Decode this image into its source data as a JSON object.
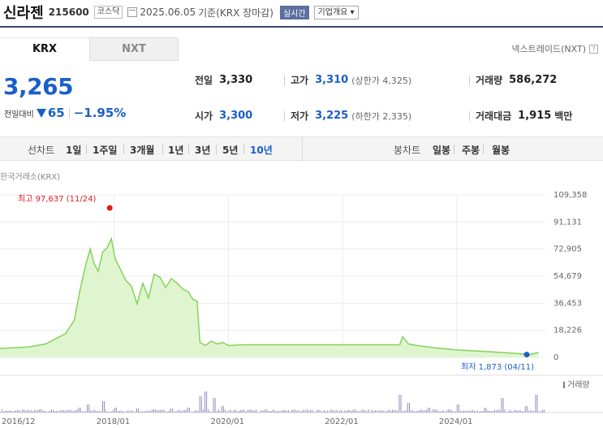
{
  "header": {
    "name": "신라젠",
    "code": "215600",
    "market": "코스닥",
    "date": "2025.06.05",
    "basis": "기준(KRX 장마감)",
    "live_label": "실시간",
    "info_label": "기업개요 ▾"
  },
  "tabs": [
    {
      "label": "KRX"
    },
    {
      "label": "NXT"
    }
  ],
  "nxt_link": "넥스트레이드(NXT)",
  "nxt_help": "?",
  "quote": {
    "price": "3,265",
    "change_label": "전일대비",
    "change_amount": "65",
    "change_pct": "−1.95%",
    "prev_close_label": "전일",
    "prev_close": "3,330",
    "high_label": "고가",
    "high": "3,310",
    "upper_limit": "(상한가 4,325)",
    "volume_label": "거래량",
    "volume": "586,272",
    "open_label": "시가",
    "open": "3,300",
    "low_label": "저가",
    "low": "3,225",
    "lower_limit": "(하한가 2,335)",
    "value_label": "거래대금",
    "value": "1,915",
    "value_unit": "백만"
  },
  "period_bar": {
    "line_label": "선차트",
    "periods": [
      "1일",
      "1주일",
      "3개월",
      "1년",
      "3년",
      "5년",
      "10년"
    ],
    "selected": "10년",
    "candle_label": "봉차트",
    "candles": [
      "일봉",
      "주봉",
      "월봉"
    ]
  },
  "chart_source": "한국거래소(KRX)",
  "colors": {
    "accent": "#1a5fc9",
    "line": "#86d35a",
    "fill": "#dff5cf",
    "high": "#e21b1b",
    "volume": "#7a6fb0"
  },
  "chart_data": {
    "type": "area",
    "y_ticks": [
      "109,358",
      "91,131",
      "72,905",
      "54,679",
      "36,453",
      "18,226",
      "0"
    ],
    "ylim": [
      0,
      109358
    ],
    "x_ticks": [
      "2016/12",
      "2018/01",
      "2020/01",
      "2022/01",
      "2024/01"
    ],
    "high_annotation": "최고 97,637 (11/24)",
    "low_annotation": "최저 1,873 (04/11)",
    "volume_label": "거래량",
    "series": [
      {
        "values": [
          [
            2016.0,
            6000
          ],
          [
            2016.5,
            7000
          ],
          [
            2016.8,
            9000
          ],
          [
            2017.0,
            13000
          ],
          [
            2017.15,
            16000
          ],
          [
            2017.3,
            25000
          ],
          [
            2017.4,
            45000
          ],
          [
            2017.5,
            62000
          ],
          [
            2017.58,
            73000
          ],
          [
            2017.65,
            63000
          ],
          [
            2017.72,
            58000
          ],
          [
            2017.8,
            71000
          ],
          [
            2017.88,
            74000
          ],
          [
            2017.95,
            80000
          ],
          [
            2018.02,
            66000
          ],
          [
            2018.1,
            60000
          ],
          [
            2018.2,
            52000
          ],
          [
            2018.3,
            48000
          ],
          [
            2018.4,
            36000
          ],
          [
            2018.5,
            50000
          ],
          [
            2018.6,
            40000
          ],
          [
            2018.7,
            56000
          ],
          [
            2018.8,
            54000
          ],
          [
            2018.9,
            47000
          ],
          [
            2019.0,
            53000
          ],
          [
            2019.1,
            50000
          ],
          [
            2019.2,
            46000
          ],
          [
            2019.3,
            44000
          ],
          [
            2019.38,
            39000
          ],
          [
            2019.45,
            38000
          ],
          [
            2019.5,
            10000
          ],
          [
            2019.6,
            8000
          ],
          [
            2019.7,
            11000
          ],
          [
            2019.8,
            9000
          ],
          [
            2019.9,
            10000
          ],
          [
            2020.0,
            8000
          ],
          [
            2020.3,
            8500
          ],
          [
            2021.0,
            8500
          ],
          [
            2022.0,
            8500
          ],
          [
            2022.5,
            8500
          ],
          [
            2023.0,
            8500
          ],
          [
            2023.05,
            14000
          ],
          [
            2023.15,
            9000
          ],
          [
            2023.3,
            8000
          ],
          [
            2023.6,
            6500
          ],
          [
            2024.0,
            5000
          ],
          [
            2024.5,
            4000
          ],
          [
            2024.9,
            3000
          ],
          [
            2025.28,
            1873
          ],
          [
            2025.43,
            3265
          ]
        ]
      }
    ],
    "volume_bars": [
      [
        2016.3,
        3
      ],
      [
        2016.7,
        4
      ],
      [
        2017.1,
        3
      ],
      [
        2017.4,
        6
      ],
      [
        2017.55,
        10
      ],
      [
        2017.8,
        14
      ],
      [
        2018.0,
        6
      ],
      [
        2018.4,
        5
      ],
      [
        2018.7,
        4
      ],
      [
        2019.0,
        5
      ],
      [
        2019.3,
        6
      ],
      [
        2019.5,
        20
      ],
      [
        2019.6,
        26
      ],
      [
        2019.75,
        18
      ],
      [
        2019.9,
        8
      ],
      [
        2023.0,
        22
      ],
      [
        2023.15,
        12
      ],
      [
        2023.5,
        6
      ],
      [
        2024.0,
        10
      ],
      [
        2024.5,
        6
      ],
      [
        2024.8,
        18
      ],
      [
        2025.2,
        8
      ],
      [
        2025.4,
        22
      ]
    ]
  }
}
